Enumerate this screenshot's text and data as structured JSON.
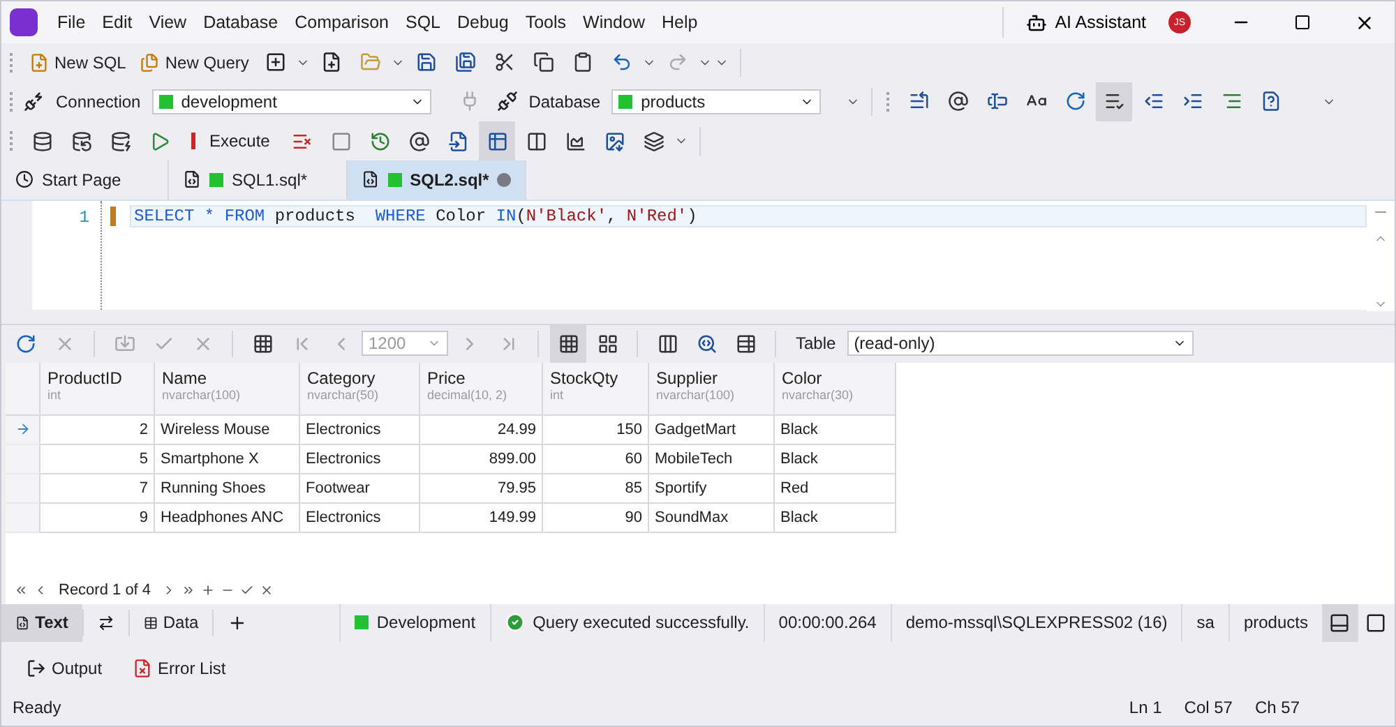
{
  "menu": [
    "File",
    "Edit",
    "View",
    "Database",
    "Comparison",
    "SQL",
    "Debug",
    "Tools",
    "Window",
    "Help"
  ],
  "ai_assistant": {
    "label": "AI Assistant"
  },
  "user_avatar": {
    "initials": "JS"
  },
  "toolbar_main": {
    "new_sql": "New SQL",
    "new_query": "New Query"
  },
  "connection_bar": {
    "connection_label": "Connection",
    "connection": {
      "value": "development",
      "color": "#22c232"
    },
    "database_label": "Database",
    "database": {
      "value": "products",
      "color": "#22c232"
    }
  },
  "format_tools": [
    {
      "pressed": false
    },
    {
      "pressed": false
    },
    {
      "pressed": false
    },
    {
      "pressed": false
    },
    {
      "pressed": false
    },
    {
      "pressed": true
    },
    {
      "pressed": false
    },
    {
      "pressed": false
    },
    {
      "pressed": false
    },
    {
      "pressed": false
    }
  ],
  "execute_tools": [
    {
      "kind": "icon",
      "pressed": false
    },
    {
      "kind": "icon",
      "pressed": false
    },
    {
      "kind": "icon",
      "pressed": false
    },
    {
      "kind": "icon",
      "pressed": false
    },
    {
      "kind": "labeled",
      "label": "Execute",
      "pressed": false
    },
    {
      "kind": "icon",
      "pressed": false
    },
    {
      "kind": "icon",
      "pressed": false
    },
    {
      "kind": "icon",
      "pressed": false
    },
    {
      "kind": "icon",
      "pressed": false
    },
    {
      "kind": "icon",
      "pressed": false
    },
    {
      "kind": "icon",
      "pressed": true
    },
    {
      "kind": "icon",
      "pressed": false
    },
    {
      "kind": "icon",
      "pressed": false
    },
    {
      "kind": "icon",
      "pressed": false
    },
    {
      "kind": "icon",
      "pressed": false
    }
  ],
  "tabs": [
    {
      "kind": "start",
      "label": "Start Page",
      "selected": false
    },
    {
      "kind": "sql",
      "label": "SQL1.sql*",
      "selected": false
    },
    {
      "kind": "sql",
      "label": "SQL2.sql*",
      "selected": true
    }
  ],
  "editor": {
    "line_numbers": [
      "1"
    ],
    "tokens": [
      {
        "kind": "keyword",
        "text": "SELECT"
      },
      {
        "kind": "keyword",
        "text": " *"
      },
      {
        "kind": "keyword",
        "text": " FROM"
      },
      {
        "kind": "plain",
        "text": " products  "
      },
      {
        "kind": "keyword",
        "text": "WHERE"
      },
      {
        "kind": "plain",
        "text": " Color "
      },
      {
        "kind": "keyword",
        "text": "IN"
      },
      {
        "kind": "plain",
        "text": "("
      },
      {
        "kind": "string",
        "text": "N'Black'"
      },
      {
        "kind": "plain",
        "text": ", "
      },
      {
        "kind": "string",
        "text": "N'Red'"
      },
      {
        "kind": "plain",
        "text": ")"
      }
    ]
  },
  "grid_toolbar": {
    "page_size": "1200",
    "views": [
      {
        "pressed": true
      },
      {
        "pressed": false
      }
    ],
    "table_label": "Table",
    "table_value": "(read-only)"
  },
  "table": {
    "columns": [
      {
        "name": "ProductID",
        "type": "int",
        "kind": "number"
      },
      {
        "name": "Name",
        "type": "nvarchar(100)",
        "kind": "text"
      },
      {
        "name": "Category",
        "type": "nvarchar(50)",
        "kind": "text"
      },
      {
        "name": "Price",
        "type": "decimal(10, 2)",
        "kind": "number"
      },
      {
        "name": "StockQty",
        "type": "int",
        "kind": "number"
      },
      {
        "name": "Supplier",
        "type": "nvarchar(100)",
        "kind": "text"
      },
      {
        "name": "Color",
        "type": "nvarchar(30)",
        "kind": "text"
      }
    ],
    "rows": [
      {
        "selected": true,
        "cells": [
          "2",
          "Wireless Mouse",
          "Electronics",
          "24.99",
          "150",
          "GadgetMart",
          "Black"
        ]
      },
      {
        "selected": false,
        "cells": [
          "5",
          "Smartphone X",
          "Electronics",
          "899.00",
          "60",
          "MobileTech",
          "Black"
        ]
      },
      {
        "selected": false,
        "cells": [
          "7",
          "Running Shoes",
          "Footwear",
          "79.95",
          "85",
          "Sportify",
          "Red"
        ]
      },
      {
        "selected": false,
        "cells": [
          "9",
          "Headphones ANC",
          "Electronics",
          "149.99",
          "90",
          "SoundMax",
          "Black"
        ]
      }
    ]
  },
  "navigator": {
    "record": "Record 1 of 4"
  },
  "results_bar": {
    "modes": [
      {
        "kind": "text",
        "label": "Text",
        "selected": true
      },
      {
        "kind": "swap",
        "selected": false
      },
      {
        "kind": "data",
        "label": "Data",
        "selected": false
      }
    ],
    "connection": {
      "label": "Development",
      "color": "#22c232"
    },
    "message": "Query executed successfully.",
    "elapsed": "00:00:00.264",
    "server": "demo-mssql\\SQLEXPRESS02 (16)",
    "user": "sa",
    "database": "products",
    "layouts": [
      {
        "pressed": true
      },
      {
        "pressed": false
      }
    ]
  },
  "output_bar": [
    {
      "kind": "output",
      "label": "Output"
    },
    {
      "kind": "errors",
      "label": "Error List"
    }
  ],
  "status_bar": {
    "state": "Ready",
    "line": "Ln 1",
    "column": "Col 57",
    "char": "Ch 57"
  }
}
